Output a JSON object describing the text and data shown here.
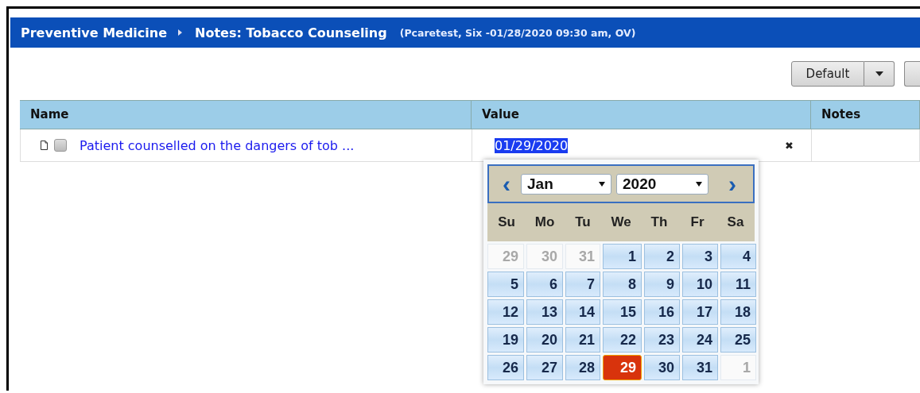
{
  "header": {
    "breadcrumb": "Preventive Medicine",
    "title": "Notes: Tobacco Counseling",
    "context": "(Pcaretest, Six -01/28/2020 09:30 am, OV)"
  },
  "toolbar": {
    "default_button": "Default"
  },
  "table": {
    "columns": [
      "Name",
      "Value",
      "Notes"
    ],
    "rows": [
      {
        "name": "Patient counselled on the dangers of tob ...",
        "checked": false,
        "value": "01/29/2020",
        "clear": "✖"
      }
    ]
  },
  "datepicker": {
    "prev": "‹",
    "next": "›",
    "month": "Jan",
    "year": "2020",
    "weekdays": [
      "Su",
      "Mo",
      "Tu",
      "We",
      "Th",
      "Fr",
      "Sa"
    ],
    "days": [
      {
        "text": "29",
        "kind": "other",
        "selected": false
      },
      {
        "text": "30",
        "kind": "other",
        "selected": false
      },
      {
        "text": "31",
        "kind": "other",
        "selected": false
      },
      {
        "text": "1",
        "kind": "current",
        "selected": false
      },
      {
        "text": "2",
        "kind": "current",
        "selected": false
      },
      {
        "text": "3",
        "kind": "current",
        "selected": false
      },
      {
        "text": "4",
        "kind": "current",
        "selected": false
      },
      {
        "text": "5",
        "kind": "current",
        "selected": false
      },
      {
        "text": "6",
        "kind": "current",
        "selected": false
      },
      {
        "text": "7",
        "kind": "current",
        "selected": false
      },
      {
        "text": "8",
        "kind": "current",
        "selected": false
      },
      {
        "text": "9",
        "kind": "current",
        "selected": false
      },
      {
        "text": "10",
        "kind": "current",
        "selected": false
      },
      {
        "text": "11",
        "kind": "current",
        "selected": false
      },
      {
        "text": "12",
        "kind": "current",
        "selected": false
      },
      {
        "text": "13",
        "kind": "current",
        "selected": false
      },
      {
        "text": "14",
        "kind": "current",
        "selected": false
      },
      {
        "text": "15",
        "kind": "current",
        "selected": false
      },
      {
        "text": "16",
        "kind": "current",
        "selected": false
      },
      {
        "text": "17",
        "kind": "current",
        "selected": false
      },
      {
        "text": "18",
        "kind": "current",
        "selected": false
      },
      {
        "text": "19",
        "kind": "current",
        "selected": false
      },
      {
        "text": "20",
        "kind": "current",
        "selected": false
      },
      {
        "text": "21",
        "kind": "current",
        "selected": false
      },
      {
        "text": "22",
        "kind": "current",
        "selected": false
      },
      {
        "text": "23",
        "kind": "current",
        "selected": false
      },
      {
        "text": "24",
        "kind": "current",
        "selected": false
      },
      {
        "text": "25",
        "kind": "current",
        "selected": false
      },
      {
        "text": "26",
        "kind": "current",
        "selected": false
      },
      {
        "text": "27",
        "kind": "current",
        "selected": false
      },
      {
        "text": "28",
        "kind": "current",
        "selected": false
      },
      {
        "text": "29",
        "kind": "current",
        "selected": true
      },
      {
        "text": "30",
        "kind": "current",
        "selected": false
      },
      {
        "text": "31",
        "kind": "current",
        "selected": false
      },
      {
        "text": "1",
        "kind": "other",
        "selected": false
      }
    ]
  }
}
